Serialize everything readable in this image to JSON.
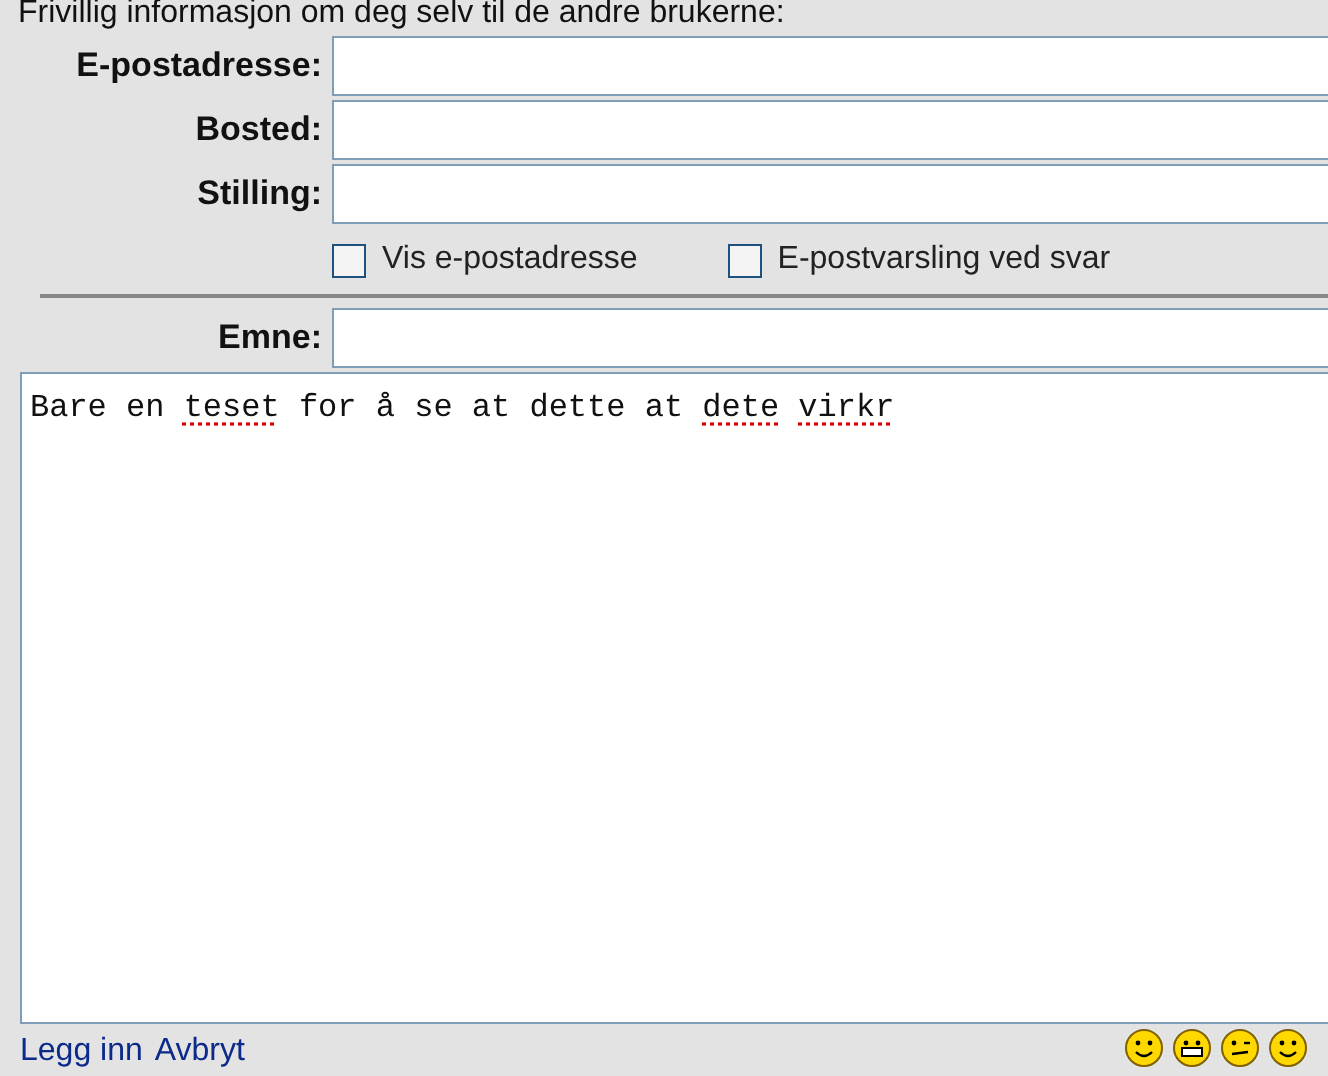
{
  "intro": "Frivillig informasjon om deg selv til de andre brukerne:",
  "fields": [
    {
      "label": "E-postadresse:"
    },
    {
      "label": "Bosted:"
    },
    {
      "label": "Stilling:"
    }
  ],
  "options": [
    {
      "label": "Vis e-postadresse",
      "checked": false
    },
    {
      "label": "E-postvarsling ved svar",
      "checked": false
    }
  ],
  "subject": {
    "label": "Emne:"
  },
  "body": {
    "words": [
      {
        "text": "Bare",
        "misspelled": false
      },
      {
        "text": "en",
        "misspelled": false
      },
      {
        "text": "teset",
        "misspelled": true
      },
      {
        "text": "for",
        "misspelled": false
      },
      {
        "text": "å",
        "misspelled": false
      },
      {
        "text": "se",
        "misspelled": false
      },
      {
        "text": "at",
        "misspelled": false
      },
      {
        "text": "dette",
        "misspelled": false
      },
      {
        "text": "at",
        "misspelled": false
      },
      {
        "text": "dete",
        "misspelled": true
      },
      {
        "text": "virkr",
        "misspelled": true
      }
    ]
  },
  "links": [
    "Legg inn",
    "Avbryt"
  ],
  "smileys": [
    {
      "kind": "smile"
    },
    {
      "kind": "grin"
    },
    {
      "kind": "wink"
    },
    {
      "kind": "smile"
    }
  ]
}
